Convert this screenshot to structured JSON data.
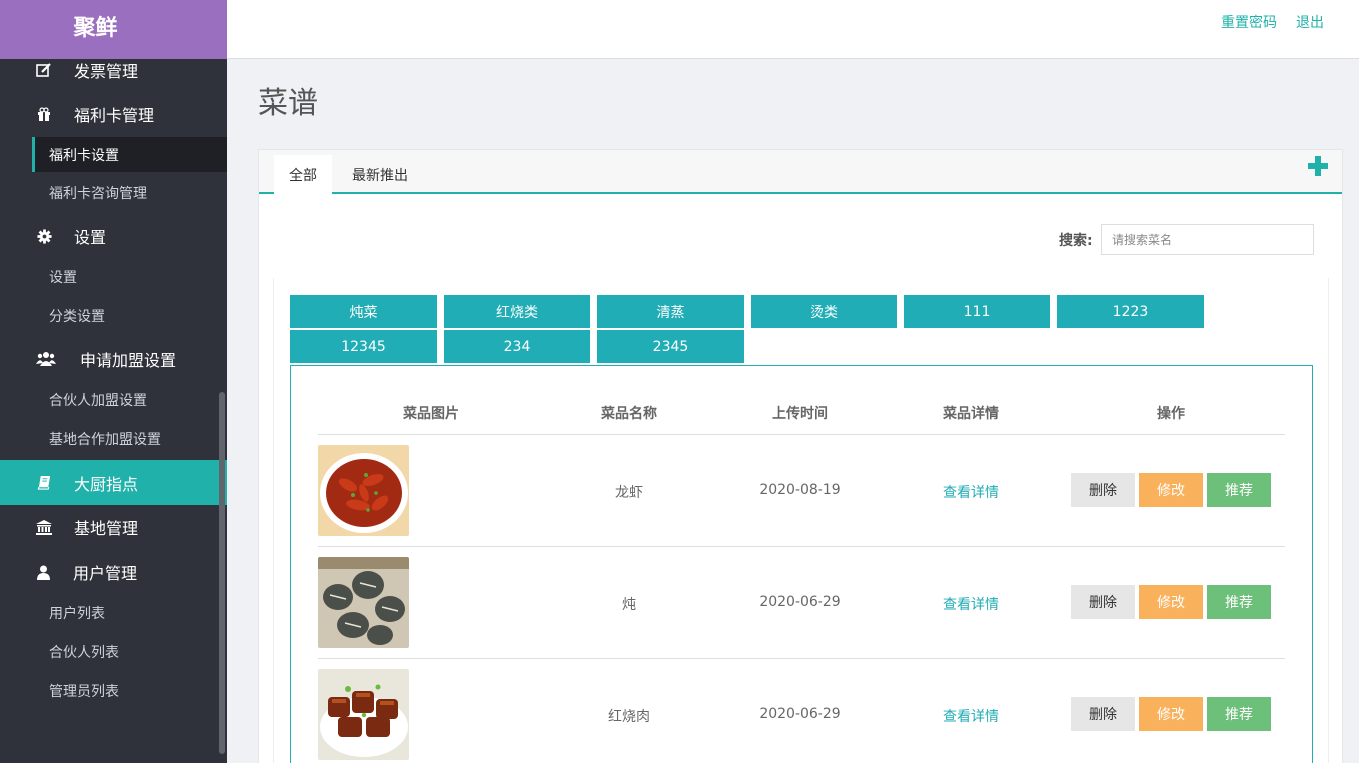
{
  "app": {
    "logo": "聚鲜"
  },
  "sidebar": {
    "items": [
      {
        "label": "发票管理",
        "icon": "edit-icon",
        "type": "menu"
      },
      {
        "label": "福利卡管理",
        "icon": "gift-icon",
        "type": "menu"
      },
      {
        "label": "福利卡设置",
        "type": "sub",
        "current": true
      },
      {
        "label": "福利卡咨询管理",
        "type": "sub"
      },
      {
        "label": "设置",
        "icon": "gear-icon",
        "type": "menu"
      },
      {
        "label": "设置",
        "type": "sub"
      },
      {
        "label": "分类设置",
        "type": "sub"
      },
      {
        "label": "申请加盟设置",
        "icon": "users-icon",
        "type": "menu"
      },
      {
        "label": "合伙人加盟设置",
        "type": "sub"
      },
      {
        "label": "基地合作加盟设置",
        "type": "sub"
      },
      {
        "label": "大厨指点",
        "icon": "book-icon",
        "type": "menu",
        "active": true
      },
      {
        "label": "基地管理",
        "icon": "bank-icon",
        "type": "menu"
      },
      {
        "label": "用户管理",
        "icon": "user-icon",
        "type": "menu"
      },
      {
        "label": "用户列表",
        "type": "sub"
      },
      {
        "label": "合伙人列表",
        "type": "sub"
      },
      {
        "label": "管理员列表",
        "type": "sub"
      }
    ]
  },
  "header": {
    "reset_password": "重置密码",
    "logout": "退出"
  },
  "page": {
    "title": "菜谱"
  },
  "tabs": [
    {
      "label": "全部",
      "active": true
    },
    {
      "label": "最新推出"
    }
  ],
  "search": {
    "label": "搜索:",
    "placeholder": "请搜索菜名",
    "value": ""
  },
  "categories": [
    "炖菜",
    "红烧类",
    "清蒸",
    "烫类",
    "111",
    "1223",
    "12345",
    "234",
    "2345"
  ],
  "table": {
    "headers": [
      "菜品图片",
      "菜品名称",
      "上传时间",
      "菜品详情",
      "操作"
    ],
    "rows": [
      {
        "name": "龙虾",
        "date": "2020-08-19",
        "detail": "查看详情"
      },
      {
        "name": "炖",
        "date": "2020-06-29",
        "detail": "查看详情"
      },
      {
        "name": "红烧肉",
        "date": "2020-06-29",
        "detail": "查看详情"
      }
    ],
    "actions": {
      "delete": "删除",
      "edit": "修改",
      "recommend": "推荐"
    }
  },
  "colors": {
    "accent": "#20b2aa",
    "logo_bg": "#9b6fbf",
    "sidebar_bg": "#2f323a",
    "edit": "#f9b15c",
    "recommend": "#6cc07a"
  }
}
